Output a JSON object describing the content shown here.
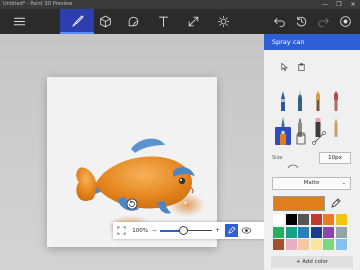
{
  "window": {
    "title": "Untitled* - Paint 3D Preview",
    "controls": [
      "—",
      "❐",
      "✕"
    ]
  },
  "toolbar": {
    "items": [
      {
        "name": "menu-icon"
      },
      {
        "name": "brush-icon"
      },
      {
        "name": "cube-icon"
      },
      {
        "name": "sticker-icon"
      },
      {
        "name": "text-icon"
      },
      {
        "name": "canvas-icon"
      },
      {
        "name": "effects-icon"
      },
      {
        "name": "undo-icon"
      },
      {
        "name": "history-icon"
      },
      {
        "name": "redo-icon"
      },
      {
        "name": "remix-icon"
      }
    ]
  },
  "panel": {
    "title": "Spray can",
    "size_label": "Size",
    "size_value": "10px",
    "finish_value": "Matte",
    "selected_color": "#e07d1c",
    "add_color_label": "+ Add color",
    "palette": [
      "#ffffff",
      "#000000",
      "#555555",
      "#c0392b",
      "#e67e22",
      "#f1c40f",
      "#27ae60",
      "#16a085",
      "#2980b9",
      "#1e3a8a",
      "#8e44ad",
      "#95a5a6",
      "#a0522d",
      "#e6b0c4",
      "#f7c8a0",
      "#f9e79f",
      "#7dd87d",
      "#85c1e9"
    ]
  },
  "bottom": {
    "zoom": "100%"
  }
}
